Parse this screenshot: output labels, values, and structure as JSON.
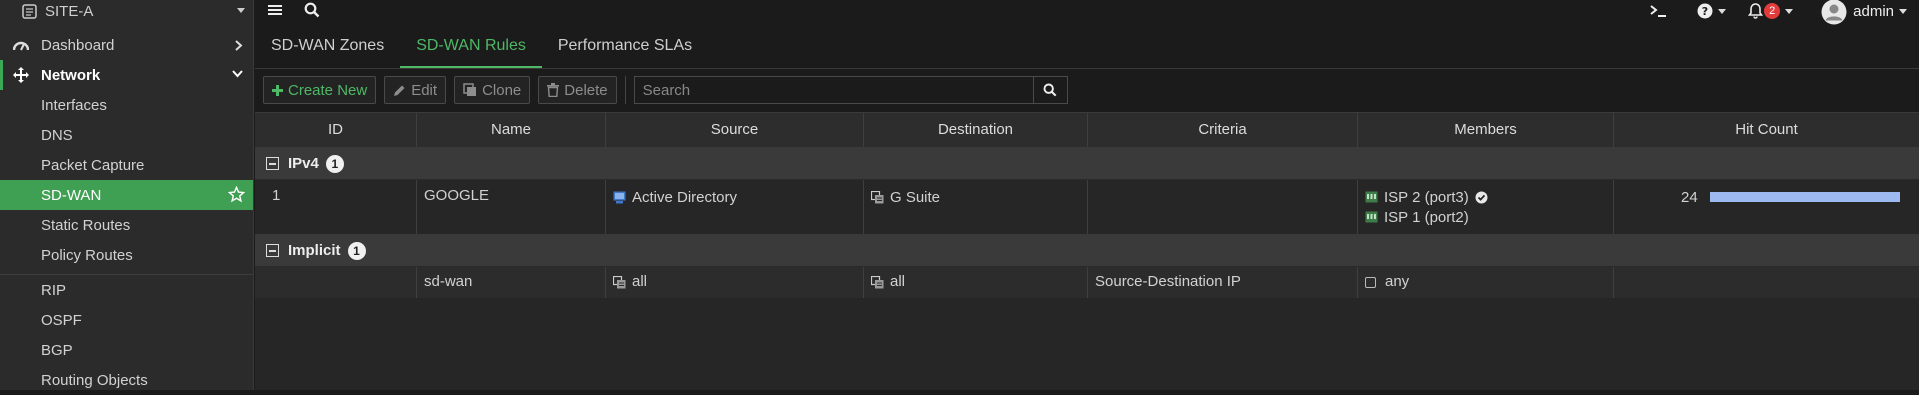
{
  "sidebar": {
    "device": "SITE-A",
    "top_items": [
      {
        "label": "Dashboard",
        "icon": "dashboard-icon"
      },
      {
        "label": "Network",
        "icon": "network-move-icon"
      }
    ],
    "network_items": [
      {
        "label": "Interfaces"
      },
      {
        "label": "DNS"
      },
      {
        "label": "Packet Capture"
      },
      {
        "label": "SD-WAN"
      },
      {
        "label": "Static Routes"
      },
      {
        "label": "Policy Routes"
      },
      {
        "label": "RIP"
      },
      {
        "label": "OSPF"
      },
      {
        "label": "BGP"
      },
      {
        "label": "Routing Objects"
      }
    ]
  },
  "topbar": {
    "menu_icon": "hamburger-icon",
    "search_icon": "search-icon",
    "notifications_count": "2",
    "user": "admin"
  },
  "tabs": [
    {
      "label": "SD-WAN Zones"
    },
    {
      "label": "SD-WAN Rules"
    },
    {
      "label": "Performance SLAs"
    }
  ],
  "toolbar": {
    "create": "Create New",
    "edit": "Edit",
    "clone": "Clone",
    "delete": "Delete",
    "search_placeholder": "Search"
  },
  "table": {
    "columns": [
      "ID",
      "Name",
      "Source",
      "Destination",
      "Criteria",
      "Members",
      "Hit Count"
    ],
    "groups": [
      {
        "label": "IPv4",
        "count": "1",
        "rows": [
          {
            "id": "1",
            "name": "GOOGLE",
            "source": "Active Directory",
            "destination": "G Suite",
            "criteria": "",
            "members": [
              "ISP 2 (port3)",
              "ISP 1 (port2)"
            ],
            "hit_count": "24",
            "hit_fraction": 1.0
          }
        ]
      },
      {
        "label": "Implicit",
        "count": "1",
        "rows": [
          {
            "id": "",
            "name": "sd-wan",
            "source": "all",
            "destination": "all",
            "criteria": "Source-Destination IP",
            "members": [
              "any"
            ],
            "hit_count": ""
          }
        ]
      }
    ]
  },
  "colors": {
    "accent_green": "#4fb866",
    "active_bg": "#3f9f52",
    "hit_bar": "#9db9f0",
    "alert_red": "#e23b3b"
  }
}
